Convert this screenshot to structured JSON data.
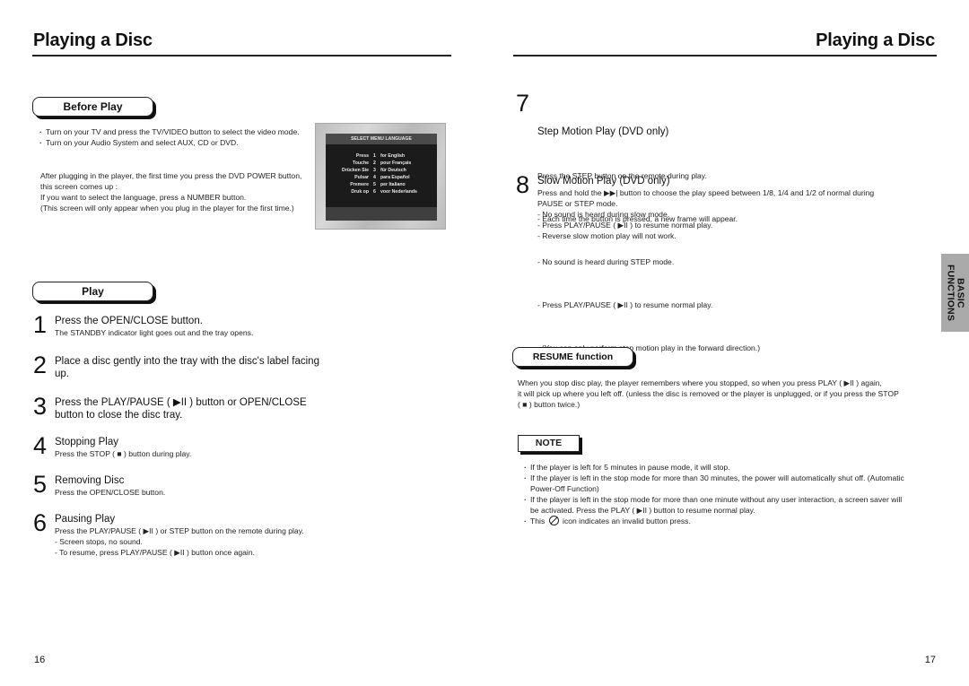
{
  "left_page": {
    "title": "Playing a Disc",
    "page_number": "16",
    "before_play": {
      "heading": "Before Play",
      "bullets": [
        "Turn on your TV and press the TV/VIDEO button to select the video mode.",
        "Turn on your Audio System and select AUX, CD or DVD."
      ],
      "paragraph": [
        "After plugging in the player, the first time you press the DVD POWER button, this screen comes up :",
        "If you want to select the language, press a NUMBER button.",
        "(This screen will only appear when you plug in the player for the first time.)"
      ]
    },
    "language_screen": {
      "header": "SELECT MENU LANGUAGE",
      "rows": [
        {
          "word": "Press",
          "num": "1",
          "lang": "for English"
        },
        {
          "word": "Touche",
          "num": "2",
          "lang": "pour Français"
        },
        {
          "word": "Drücken Sie",
          "num": "3",
          "lang": "für Deutsch"
        },
        {
          "word": "Pulsar",
          "num": "4",
          "lang": "para Español"
        },
        {
          "word": "Premere",
          "num": "5",
          "lang": "per Italiano"
        },
        {
          "word": "Druk op",
          "num": "6",
          "lang": "voor Nederlands"
        }
      ]
    },
    "play": {
      "heading": "Play",
      "steps": [
        {
          "num": "1",
          "title": "Press the OPEN/CLOSE button.",
          "lines": [
            "The STANDBY indicator light goes out and the tray opens."
          ]
        },
        {
          "num": "2",
          "title": "Place a disc gently into the tray with the disc's label facing up.",
          "lines": []
        },
        {
          "num": "3",
          "title": "Press the PLAY/PAUSE ( ▶II ) button or OPEN/CLOSE button to close the disc tray.",
          "lines": []
        },
        {
          "num": "4",
          "title": "Stopping Play",
          "lines": [
            "Press the STOP ( ■ ) button during play."
          ]
        },
        {
          "num": "5",
          "title": "Removing Disc",
          "lines": [
            "Press the OPEN/CLOSE button."
          ]
        },
        {
          "num": "6",
          "title": "Pausing Play",
          "lines": [
            "Press the PLAY/PAUSE ( ▶II ) or STEP button on the remote during play.",
            "- Screen stops, no sound.",
            "- To resume, press PLAY/PAUSE ( ▶II ) button once again."
          ]
        }
      ]
    }
  },
  "right_page": {
    "title": "Playing a Disc",
    "page_number": "17",
    "side_tab": "BASIC\nFUNCTIONS",
    "steps": [
      {
        "num": "7",
        "title": "Step Motion Play (DVD only)",
        "lines": [
          "Press the STEP button on the remote during play.",
          "- Each time the button is pressed, a new frame will appear.",
          "- No sound is heard during STEP mode.",
          "- Press PLAY/PAUSE ( ▶II ) to resume normal play.",
          "  (You can only perform step motion play in the forward direction.)"
        ]
      },
      {
        "num": "8",
        "title": "Slow Motion Play (DVD only)",
        "lines": [
          "Press and hold the ▶▶| button to choose the play speed between 1/8, 1/4 and 1/2 of normal during",
          "PAUSE or STEP mode.",
          "- No sound is heard during slow mode.",
          "- Press PLAY/PAUSE ( ▶II ) to resume normal play.",
          "- Reverse slow motion play will not work."
        ]
      }
    ],
    "resume": {
      "heading": "RESUME function",
      "lines": [
        "When you stop disc play, the player remembers where you stopped, so when you press PLAY ( ▶II ) again,",
        "it will pick up where you left off. (unless the disc is removed or the player is unplugged, or if you press the STOP",
        "( ■ ) button twice.)"
      ]
    },
    "note": {
      "heading": "NOTE",
      "bullets": [
        "If the player is left for 5 minutes in pause mode, it will stop.",
        "If the player is left in the stop mode for more than 30 minutes, the power will automatically shut off. (Automatic Power-Off Function)",
        "If the player is left in the stop mode for more than one minute without any user interaction, a screen saver will be activated. Press the PLAY ( ▶II ) button to resume normal play."
      ],
      "invalid_prefix": "This",
      "invalid_suffix": "icon indicates an invalid button press."
    }
  }
}
